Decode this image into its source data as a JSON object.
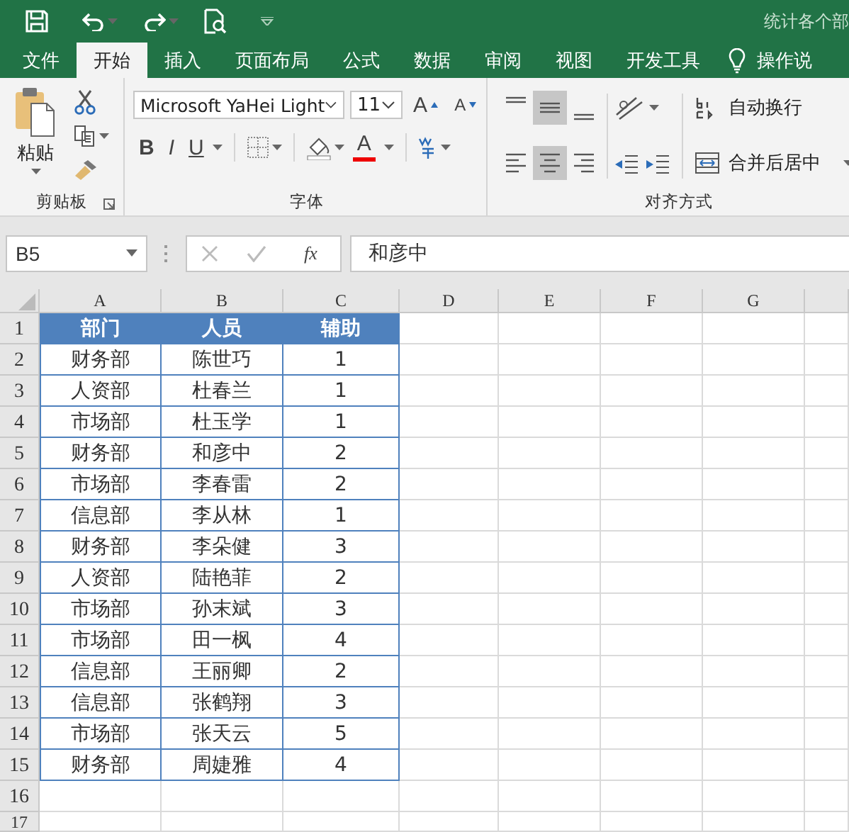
{
  "title": "统计各个部",
  "tabs": [
    {
      "label": "文件",
      "selected": false
    },
    {
      "label": "开始",
      "selected": true
    },
    {
      "label": "插入",
      "selected": false
    },
    {
      "label": "页面布局",
      "selected": false
    },
    {
      "label": "公式",
      "selected": false
    },
    {
      "label": "数据",
      "selected": false
    },
    {
      "label": "审阅",
      "selected": false
    },
    {
      "label": "视图",
      "selected": false
    },
    {
      "label": "开发工具",
      "selected": false
    }
  ],
  "tell_me": "操作说",
  "clipboard": {
    "paste": "粘贴",
    "label": "剪贴板"
  },
  "font": {
    "name": "Microsoft YaHei Light",
    "size": "11",
    "grow": "A",
    "shrink": "A",
    "style_buttons": [
      "B",
      "I",
      "U"
    ],
    "font_color": "A",
    "label": "字体"
  },
  "alignment": {
    "vertical": [
      {
        "kind": "top",
        "selected": false
      },
      {
        "kind": "middle",
        "selected": true
      },
      {
        "kind": "bottom",
        "selected": false
      }
    ],
    "horizontal": [
      {
        "kind": "left",
        "selected": false
      },
      {
        "kind": "center",
        "selected": true
      },
      {
        "kind": "right",
        "selected": false
      }
    ],
    "wrap": "自动换行",
    "merge": "合并后居中",
    "label": "对齐方式"
  },
  "formula_bar": {
    "name_box": "B5",
    "fx": "fx",
    "value": "和彦中"
  },
  "columns": [
    "A",
    "B",
    "C",
    "D",
    "E",
    "F",
    "G"
  ],
  "rows": [
    {
      "row": "1",
      "kind": "header",
      "cells": [
        "部门",
        "人员",
        "辅助"
      ]
    },
    {
      "row": "2",
      "kind": "data",
      "cells": [
        "财务部",
        "陈世巧",
        "1"
      ]
    },
    {
      "row": "3",
      "kind": "data",
      "cells": [
        "人资部",
        "杜春兰",
        "1"
      ]
    },
    {
      "row": "4",
      "kind": "data",
      "cells": [
        "市场部",
        "杜玉学",
        "1"
      ]
    },
    {
      "row": "5",
      "kind": "data",
      "cells": [
        "财务部",
        "和彦中",
        "2"
      ]
    },
    {
      "row": "6",
      "kind": "data",
      "cells": [
        "市场部",
        "李春雷",
        "2"
      ]
    },
    {
      "row": "7",
      "kind": "data",
      "cells": [
        "信息部",
        "李从林",
        "1"
      ]
    },
    {
      "row": "8",
      "kind": "data",
      "cells": [
        "财务部",
        "李朵健",
        "3"
      ]
    },
    {
      "row": "9",
      "kind": "data",
      "cells": [
        "人资部",
        "陆艳菲",
        "2"
      ]
    },
    {
      "row": "10",
      "kind": "data",
      "cells": [
        "市场部",
        "孙末斌",
        "3"
      ]
    },
    {
      "row": "11",
      "kind": "data",
      "cells": [
        "市场部",
        "田一枫",
        "4"
      ]
    },
    {
      "row": "12",
      "kind": "data",
      "cells": [
        "信息部",
        "王丽卿",
        "2"
      ]
    },
    {
      "row": "13",
      "kind": "data",
      "cells": [
        "信息部",
        "张鹤翔",
        "3"
      ]
    },
    {
      "row": "14",
      "kind": "data",
      "cells": [
        "市场部",
        "张天云",
        "5"
      ]
    },
    {
      "row": "15",
      "kind": "data",
      "cells": [
        "财务部",
        "周婕雅",
        "4"
      ]
    },
    {
      "row": "16",
      "kind": "empty"
    },
    {
      "row": "17",
      "kind": "empty"
    }
  ]
}
